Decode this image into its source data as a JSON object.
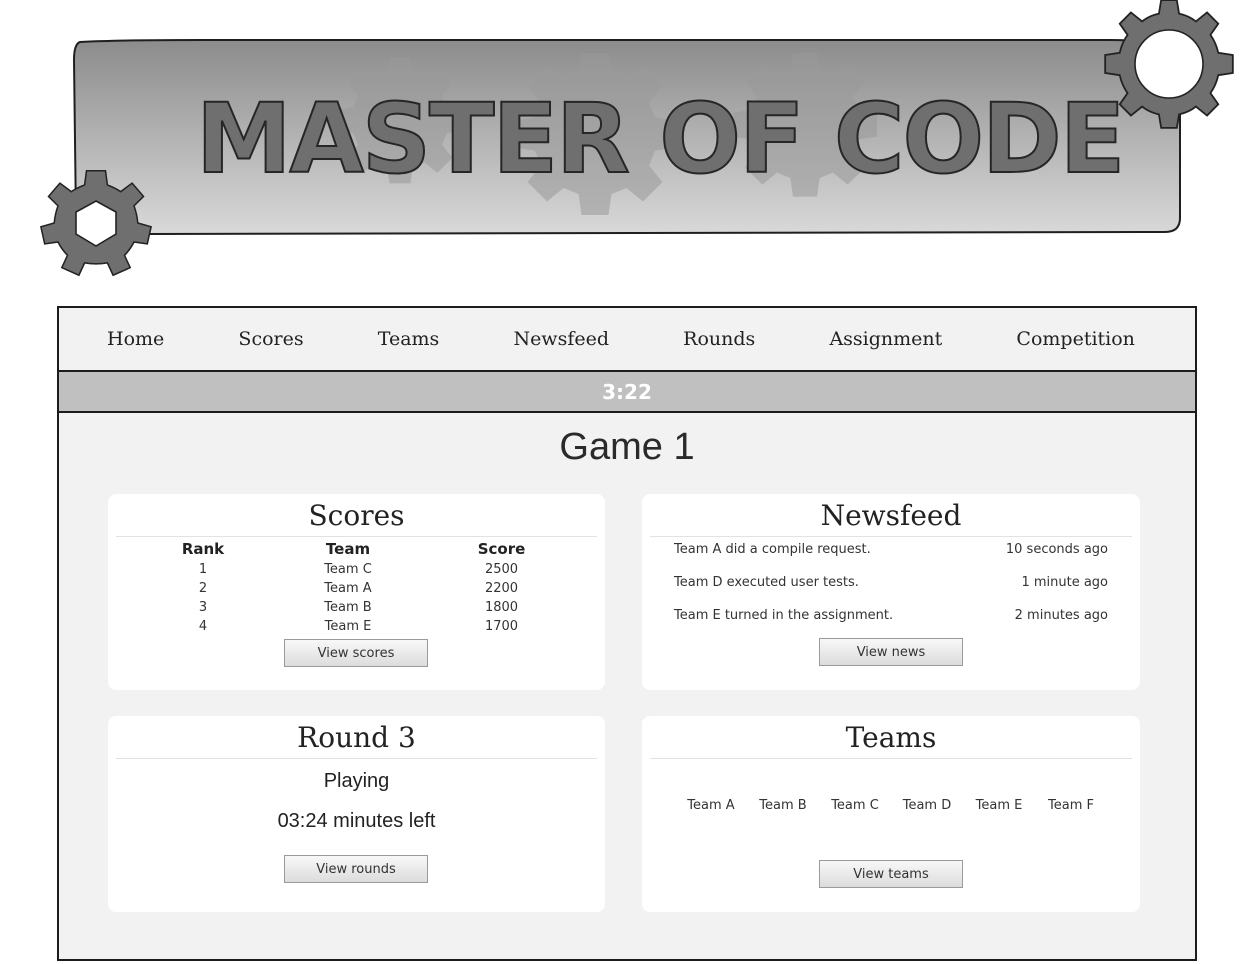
{
  "banner": {
    "title": "MASTER OF CODE"
  },
  "nav": {
    "items": [
      "Home",
      "Scores",
      "Teams",
      "Newsfeed",
      "Rounds",
      "Assignment",
      "Competition"
    ]
  },
  "timer": "3:22",
  "game": {
    "title": "Game 1"
  },
  "scores": {
    "title": "Scores",
    "columns": [
      "Rank",
      "Team",
      "Score"
    ],
    "rows": [
      [
        "1",
        "Team C",
        "2500"
      ],
      [
        "2",
        "Team A",
        "2200"
      ],
      [
        "3",
        "Team B",
        "1800"
      ],
      [
        "4",
        "Team E",
        "1700"
      ]
    ],
    "button": "View scores"
  },
  "newsfeed": {
    "title": "Newsfeed",
    "items": [
      {
        "text": "Team A did a compile request.",
        "time": "10 seconds ago"
      },
      {
        "text": "Team D executed user tests.",
        "time": "1 minute ago"
      },
      {
        "text": "Team E turned in the assignment.",
        "time": "2 minutes ago"
      }
    ],
    "button": "View news"
  },
  "round": {
    "title": "Round 3",
    "status": "Playing",
    "remaining": "03:24 minutes left",
    "button": "View rounds"
  },
  "teams": {
    "title": "Teams",
    "items": [
      "Team A",
      "Team B",
      "Team C",
      "Team D",
      "Team E",
      "Team F"
    ],
    "button": "View teams"
  },
  "colors": {
    "frame_bg": "#f2f2f2",
    "timer_bar": "#c0c0c0",
    "gear": "#6f6f6f",
    "banner_top": "#8c8c8c",
    "banner_bottom": "#d6d6d6"
  }
}
